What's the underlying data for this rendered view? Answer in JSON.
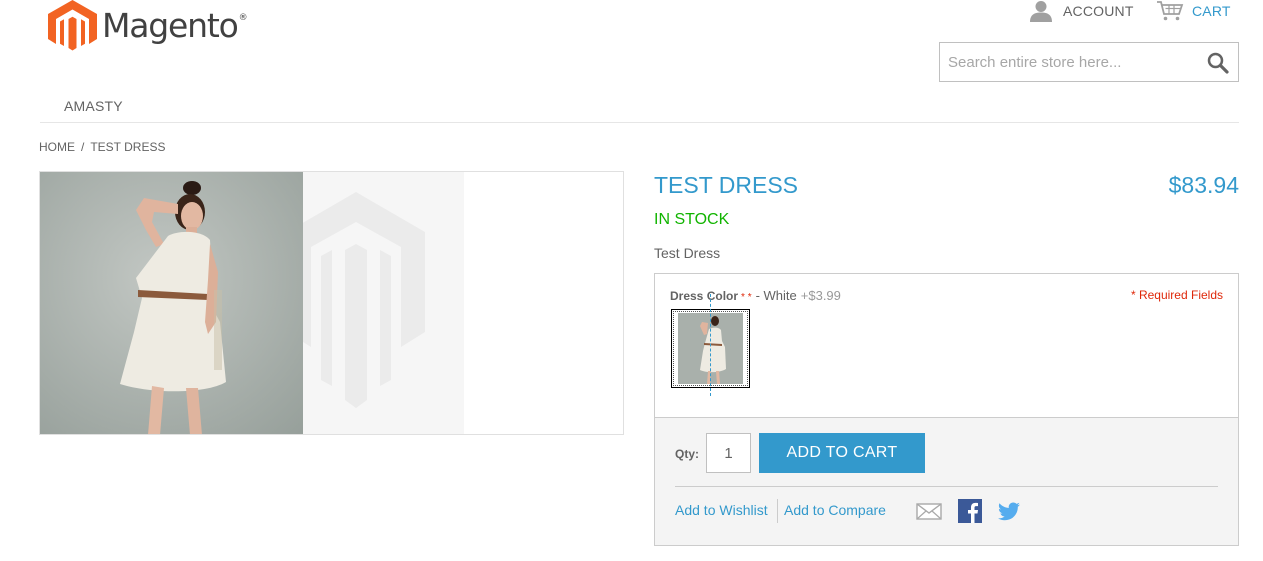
{
  "header": {
    "logo_text": "Magento",
    "logo_reg": "®",
    "account_label": "ACCOUNT",
    "cart_label": "CART",
    "search_placeholder": "Search entire store here..."
  },
  "nav": {
    "items": [
      "AMASTY"
    ]
  },
  "breadcrumb": {
    "items": [
      "HOME",
      "TEST DRESS"
    ],
    "separator": "/"
  },
  "product": {
    "name": "TEST DRESS",
    "price": "$83.94",
    "stock": "IN STOCK",
    "short_description": "Test Dress",
    "option": {
      "label": "Dress Color",
      "required_marks": "* *",
      "selected": "- White",
      "price_add": "+$3.99"
    },
    "required_note": "* Required Fields",
    "qty_label": "Qty:",
    "qty_value": "1",
    "add_to_cart_label": "ADD TO CART",
    "wishlist_label": "Add to Wishlist",
    "compare_label": "Add to Compare"
  },
  "colors": {
    "accent": "#3399cc",
    "in_stock": "#11b400",
    "required": "#df280a",
    "logo_orange": "#f26322"
  },
  "icons": {
    "account": "user-icon",
    "cart": "cart-icon",
    "search": "magnifier-icon",
    "email": "email-icon",
    "facebook": "facebook-icon",
    "twitter": "twitter-icon"
  }
}
